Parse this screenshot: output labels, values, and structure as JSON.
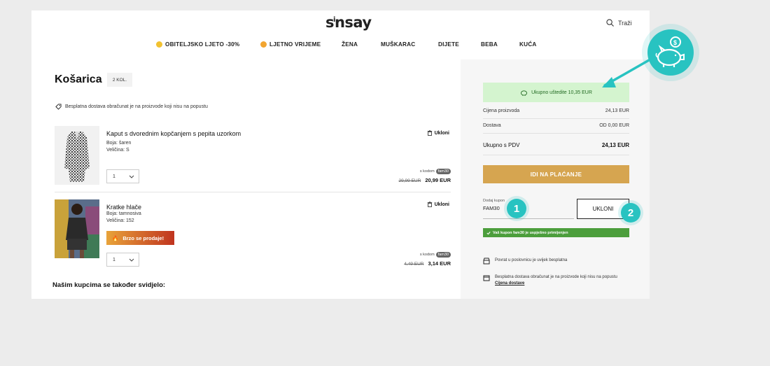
{
  "header": {
    "logo": "sinsay",
    "search_label": "Traži",
    "nav": [
      {
        "label": "OBITELJSKO LJETO -30%",
        "emoji_color": "#f2c230"
      },
      {
        "label": "LJETNO VRIJEME",
        "emoji_color": "#f2a530"
      },
      {
        "label": "ŽENA"
      },
      {
        "label": "MUŠKARAC"
      },
      {
        "label": "DIJETE"
      },
      {
        "label": "BEBA"
      },
      {
        "label": "KUĆA"
      }
    ]
  },
  "cart": {
    "title": "Košarica",
    "count_badge": "2 KOL.",
    "delivery_note": "Besplatna dostava obračunat je na proizvode koji nisu na popustu",
    "remove_label": "Ukloni",
    "code_prefix": "s kodom",
    "items": [
      {
        "name": "Kaput s dvorednim kopčanjem s pepita uzorkom",
        "color": "Boja: šaren",
        "size": "Veličina: S",
        "qty": "1",
        "code": "fam30",
        "old_price": "29,99 EUR",
        "new_price": "20,99 EUR"
      },
      {
        "name": "Kratke hlače",
        "color": "Boja: tamnosiva",
        "size": "Veličina: 152",
        "qty": "1",
        "badge": "Brzo se prodaje!",
        "code": "fam30",
        "old_price": "4,49 EUR",
        "new_price": "3,14 EUR"
      }
    ],
    "recommendations_title": "Našim kupcima se također svidjelo:"
  },
  "summary": {
    "saving_text": "Ukupno uštedite 10,35 EUR",
    "rows": [
      {
        "label": "Cijena proizvoda",
        "value": "24,13 EUR"
      },
      {
        "label": "Dostava",
        "value": "OD 0,00 EUR"
      }
    ],
    "total_label": "Ukupno s PDV",
    "total_value": "24,13 EUR",
    "checkout_label": "IDI NA PLAĆANJE",
    "coupon_label": "Dodaj kupon",
    "coupon_value": "FAM30",
    "remove_coupon_label": "UKLONI",
    "coupon_success": "Vaš kupon fam30 je uspješno primijenjen",
    "info": [
      {
        "text": "Povrat u poslovnicu je uvijek besplatna"
      },
      {
        "text": "Besplatna dostava obračunat je na proizvode koji nisu na popustu",
        "link": "Cijena dostave"
      }
    ]
  },
  "annotations": {
    "step1": "1",
    "step2": "2",
    "accent": "#28c3c1"
  }
}
